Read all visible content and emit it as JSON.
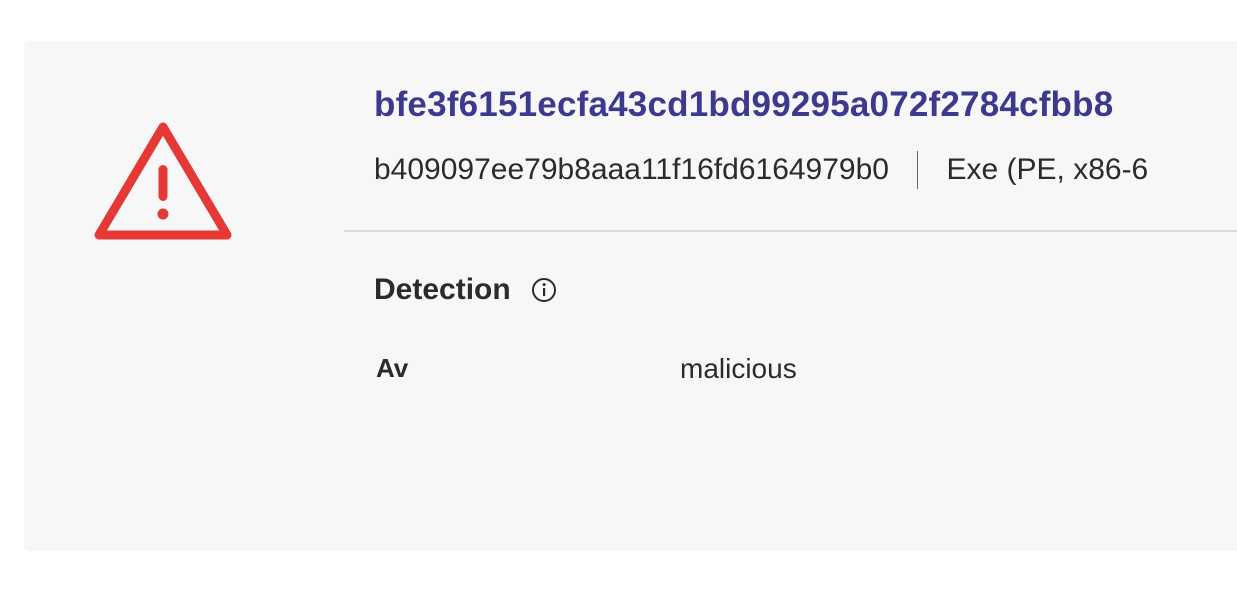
{
  "file": {
    "hash_title": "bfe3f6151ecfa43cd1bd99295a072f2784cfbb8",
    "md5": "b409097ee79b8aaa11f16fd6164979b0",
    "type": "Exe (PE, x86-6"
  },
  "detection": {
    "heading": "Detection",
    "rows": [
      {
        "label": "Av",
        "value": "malicious"
      }
    ]
  },
  "icons": {
    "status": "warning-triangle-icon",
    "info": "info-circle-icon"
  },
  "colors": {
    "warning": "#e53935",
    "title": "#3b3a8f",
    "card_bg": "#f7f7f7"
  }
}
